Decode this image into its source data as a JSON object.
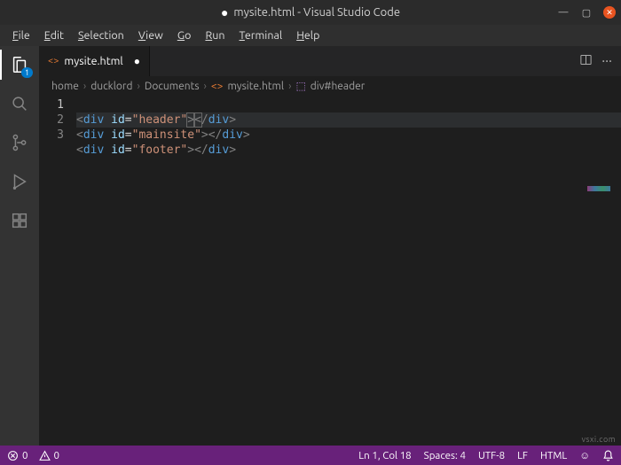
{
  "window": {
    "title": "mysite.html - Visual Studio Code",
    "dirty": true
  },
  "menu": {
    "file": "File",
    "edit": "Edit",
    "selection": "Selection",
    "view": "View",
    "go": "Go",
    "run": "Run",
    "terminal": "Terminal",
    "help": "Help"
  },
  "activity": {
    "explorer_badge": "1"
  },
  "tab": {
    "filename": "mysite.html"
  },
  "breadcrumbs": {
    "p0": "home",
    "p1": "ducklord",
    "p2": "Documents",
    "p3": "mysite.html",
    "p4": "div#header"
  },
  "code": {
    "lines": [
      {
        "num": "1",
        "tag": "div",
        "attr": "id",
        "val": "\"header\""
      },
      {
        "num": "2",
        "tag": "div",
        "attr": "id",
        "val": "\"mainsite\""
      },
      {
        "num": "3",
        "tag": "div",
        "attr": "id",
        "val": "\"footer\""
      }
    ]
  },
  "status": {
    "errors": "0",
    "warnings": "0",
    "ln_col": "Ln 1, Col 18",
    "spaces": "Spaces: 4",
    "encoding": "UTF-8",
    "eol": "LF",
    "lang": "HTML"
  },
  "watermark": "vsxi.com"
}
